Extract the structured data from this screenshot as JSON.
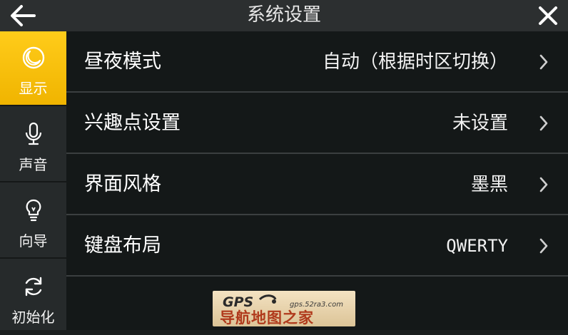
{
  "header": {
    "title": "系统设置"
  },
  "sidebar": {
    "items": [
      {
        "label": "显示",
        "icon": "moon-icon",
        "active": true
      },
      {
        "label": "声音",
        "icon": "microphone-icon",
        "active": false
      },
      {
        "label": "向导",
        "icon": "lightbulb-icon",
        "active": false
      },
      {
        "label": "初始化",
        "icon": "refresh-icon",
        "active": false
      }
    ]
  },
  "settings": {
    "rows": [
      {
        "label": "昼夜模式",
        "value": "自动（根据时区切换）"
      },
      {
        "label": "兴趣点设置",
        "value": "未设置"
      },
      {
        "label": "界面风格",
        "value": "墨黑"
      },
      {
        "label": "键盘布局",
        "value": "QWERTY"
      }
    ]
  },
  "watermark": {
    "brand": "GPS",
    "url": "gps.52ra3.com",
    "name": "导航地图之家"
  },
  "colors": {
    "accent": "#f5bf0a",
    "background": "#141818",
    "sidebar": "#262a2b",
    "topbar": "#2c2f30"
  }
}
